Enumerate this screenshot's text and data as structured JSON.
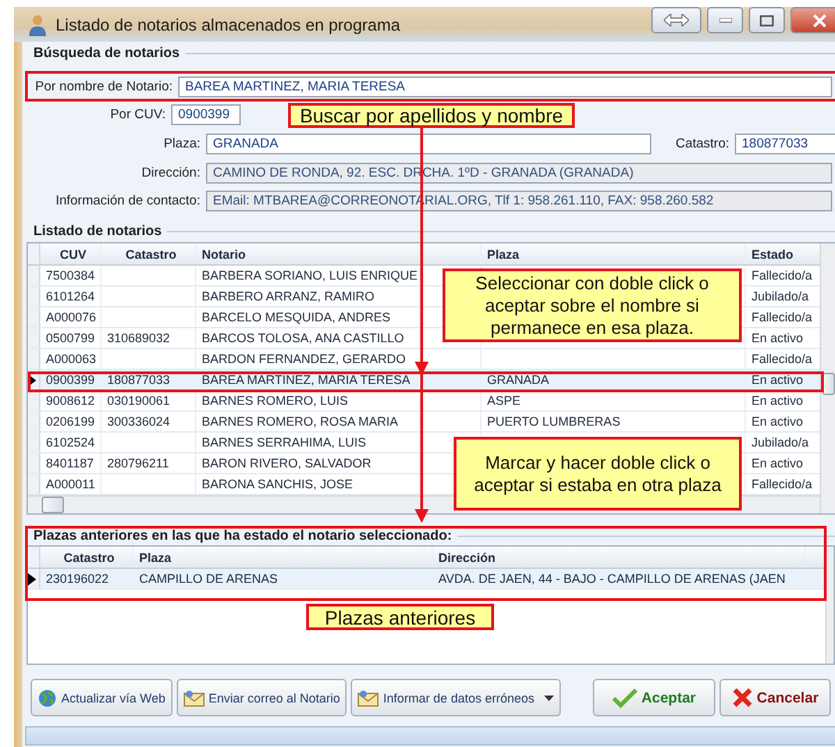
{
  "window": {
    "title": "Listado de notarios almacenados en programa"
  },
  "search": {
    "title": "Búsqueda de notarios",
    "notario": {
      "label": "Por nombre de Notario:",
      "value": "BAREA MARTINEZ, MARIA TERESA",
      "readonly": false
    },
    "cuv": {
      "label": "Por CUV:",
      "value": "0900399",
      "readonly": false
    },
    "plaza": {
      "label": "Plaza:",
      "value": "GRANADA",
      "readonly": false
    },
    "catastro": {
      "label": "Catastro:",
      "value": "180877033",
      "readonly": false
    },
    "direccion": {
      "label": "Dirección:",
      "value": "CAMINO DE RONDA, 92. ESC. DRCHA. 1ºD - GRANADA (GRANADA)",
      "readonly": true
    },
    "contacto": {
      "label": "Información de contacto:",
      "value": "EMail: MTBAREA@CORREONOTARIAL.ORG, Tlf 1: 958.261.110, FAX: 958.260.582",
      "readonly": true
    }
  },
  "list": {
    "title": "Listado de notarios",
    "columns": [
      "CUV",
      "Catastro",
      "Notario",
      "Plaza",
      "Estado"
    ],
    "rows": [
      {
        "cuv": "7500384",
        "notario": "BARBERA SORIANO, LUIS ENRIQUE",
        "estado": "Fallecido/a",
        "selected": false
      },
      {
        "cuv": "6101264",
        "notario": "BARBERO ARRANZ, RAMIRO",
        "estado": "Jubilado/a",
        "selected": false
      },
      {
        "cuv": "A000076",
        "notario": "BARCELO MESQUIDA, ANDRES",
        "estado": "Fallecido/a",
        "selected": false
      },
      {
        "cuv": "0500799",
        "catastro": "310689032",
        "notario": "BARCOS TOLOSA, ANA CASTILLO",
        "estado": "En activo",
        "selected": false
      },
      {
        "cuv": "A000063",
        "notario": "BARDON FERNANDEZ, GERARDO",
        "estado": "Fallecido/a",
        "selected": false
      },
      {
        "cuv": "0900399",
        "catastro": "180877033",
        "notario": "BAREA MARTINEZ, MARIA TERESA",
        "plaza": "GRANADA",
        "estado": "En activo",
        "selected": true
      },
      {
        "cuv": "9008612",
        "catastro": "030190061",
        "notario": "BARNES ROMERO, LUIS",
        "plaza": "ASPE",
        "estado": "En activo",
        "selected": false
      },
      {
        "cuv": "0206199",
        "catastro": "300336024",
        "notario": "BARNES ROMERO, ROSA MARIA",
        "plaza": "PUERTO LUMBRERAS",
        "estado": "En activo",
        "selected": false
      },
      {
        "cuv": "6102524",
        "notario": "BARNES SERRAHIMA, LUIS",
        "estado": "Jubilado/a",
        "selected": false
      },
      {
        "cuv": "8401187",
        "catastro": "280796211",
        "notario": "BARON RIVERO, SALVADOR",
        "estado": "En activo",
        "selected": false
      },
      {
        "cuv": "A000011",
        "notario": "BARONA SANCHIS, JOSE",
        "estado": "Fallecido/a",
        "selected": false
      }
    ]
  },
  "previous": {
    "title": "Plazas anteriores en las que ha estado el notario seleccionado:",
    "columns": [
      "Catastro",
      "Plaza",
      "Dirección"
    ],
    "rows": [
      {
        "catastro": "230196022",
        "plaza": "CAMPILLO DE ARENAS",
        "direccion": "AVDA. DE JAEN, 44 - BAJO - CAMPILLO DE ARENAS (JAEN",
        "selected": true
      }
    ]
  },
  "buttons": [
    {
      "label": "Actualizar vía Web",
      "kind": "web"
    },
    {
      "label": "Enviar correo al Notario",
      "kind": "mail"
    },
    {
      "label": "Informar de datos erróneos",
      "kind": "mail-menu"
    },
    {
      "label": "Aceptar",
      "kind": "accept"
    },
    {
      "label": "Cancelar",
      "kind": "cancel"
    }
  ],
  "annotations": [
    "Buscar por apellidos y nombre",
    "Seleccionar con doble click o aceptar sobre el nombre si permanece en esa plaza.",
    "Marcar y hacer doble click o aceptar si estaba en otra plaza",
    "Plazas anteriores"
  ]
}
